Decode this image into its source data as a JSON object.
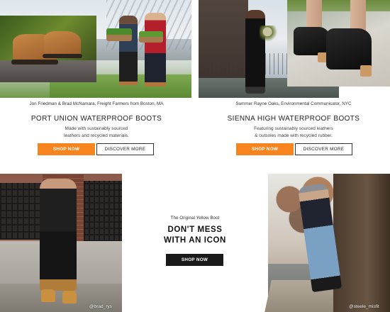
{
  "left_promo": {
    "caption": "Jon Friedman & Brad McNamara, Freight Farmers from Boston, MA",
    "title": "PORT UNION WATERPROOF BOOTS",
    "description_line1": "Made with sustainably sourced",
    "description_line2": "leathers and recycled materials.",
    "shop_label": "SHOP NOW",
    "discover_label": "DISCOVER MORE"
  },
  "right_promo": {
    "caption": "Summer Rayne Oaks, Environmental Communicator, NYC",
    "title": "SIENNA HIGH WATERPROOF BOOTS",
    "description_line1": "Featuring sustainably sourced leathers",
    "description_line2": "& outsoles made with recycled rubber.",
    "shop_label": "SHOP NOW",
    "discover_label": "DISCOVER MORE"
  },
  "center_promo": {
    "eyebrow": "The Original Yellow Boot",
    "headline_line1": "DON'T MESS",
    "headline_line2": "WITH AN ICON",
    "shop_label": "SHOP NOW"
  },
  "social": {
    "left_handle": "@brad_rys",
    "right_handle": "@steele_misfit"
  },
  "colors": {
    "accent_orange": "#f7841f",
    "button_black": "#1a1a1a",
    "text_dark": "#222222"
  }
}
